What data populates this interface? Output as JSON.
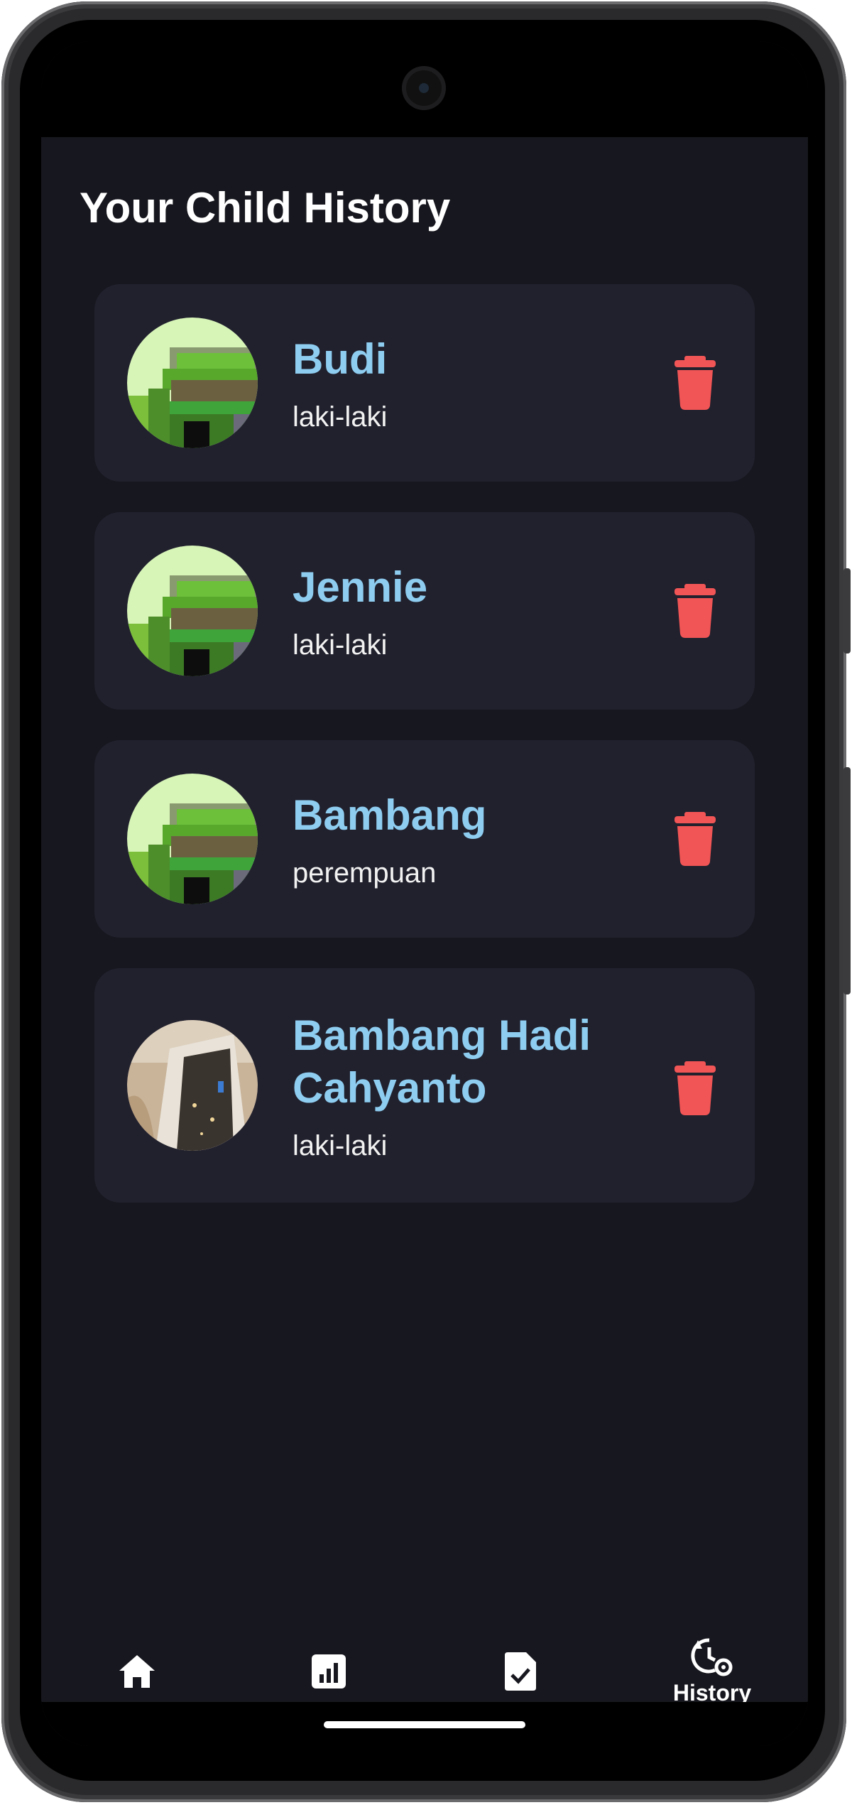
{
  "page": {
    "title": "Your Child History"
  },
  "children": [
    {
      "name": "Budi",
      "gender": "laki-laki",
      "avatar": "green-pixel-art"
    },
    {
      "name": "Jennie",
      "gender": "laki-laki",
      "avatar": "green-pixel-art"
    },
    {
      "name": "Bambang",
      "gender": "perempuan",
      "avatar": "green-pixel-art"
    },
    {
      "name": "Bambang Hadi Cahyanto",
      "gender": "laki-laki",
      "avatar": "photo-doorway"
    }
  ],
  "bottom_nav": {
    "items": [
      {
        "icon": "home-icon",
        "label": ""
      },
      {
        "icon": "chart-icon",
        "label": ""
      },
      {
        "icon": "document-check-icon",
        "label": ""
      },
      {
        "icon": "history-settings-icon",
        "label": "History",
        "active": true
      }
    ]
  },
  "colors": {
    "background": "#17171f",
    "card": "#21212e",
    "name": "#8ecdf0",
    "delete": "#f25555",
    "text": "#ffffff"
  }
}
